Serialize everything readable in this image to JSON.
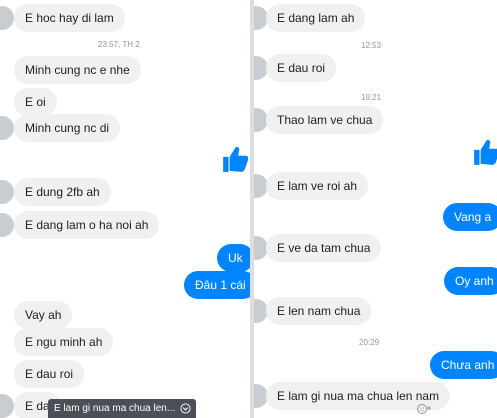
{
  "left": {
    "messages": [
      {
        "text": "E hoc hay di lam",
        "side": "in"
      },
      {
        "text": "23:57, TH 2",
        "side": "ts"
      },
      {
        "text": "Minh cung nc e nhe",
        "side": "in"
      },
      {
        "text": "E oi",
        "side": "in"
      },
      {
        "text": "Minh cung nc di",
        "side": "in"
      },
      {
        "text": "",
        "side": "like"
      },
      {
        "text": "E dung 2fb ah",
        "side": "in"
      },
      {
        "text": "E dang lam o ha noi ah",
        "side": "in"
      },
      {
        "text": "Uk",
        "side": "out"
      },
      {
        "text": "Đâu 1 cái",
        "side": "out"
      },
      {
        "text": "Vay ah",
        "side": "in"
      },
      {
        "text": "E ngu minh ah",
        "side": "in"
      },
      {
        "text": "E dau roi",
        "side": "in"
      },
      {
        "text": "E da",
        "side": "in"
      }
    ],
    "tooltip": "E lam gi nua ma chua len..."
  },
  "right": {
    "messages": [
      {
        "text": "E dang lam ah",
        "side": "in"
      },
      {
        "text": "12:53",
        "side": "ts"
      },
      {
        "text": "E dau roi",
        "side": "in"
      },
      {
        "text": "19:21",
        "side": "ts"
      },
      {
        "text": "Thao lam ve chua",
        "side": "in"
      },
      {
        "text": "",
        "side": "like"
      },
      {
        "text": "E lam ve roi ah",
        "side": "in"
      },
      {
        "text": "Vang a",
        "side": "out"
      },
      {
        "text": "E ve da tam chua",
        "side": "in"
      },
      {
        "text": "Oy anh",
        "side": "out"
      },
      {
        "text": "E len nam chua",
        "side": "in"
      },
      {
        "text": "20:29",
        "side": "ts"
      },
      {
        "text": "Chưa anh",
        "side": "out"
      },
      {
        "text": "E lam gi nua ma chua len nam",
        "side": "in"
      }
    ]
  },
  "icons": {
    "like": "thumbs-up-icon",
    "avatar": "avatar",
    "chevron": "chevron-down-icon",
    "react": "add-reaction-icon"
  },
  "colors": {
    "outgoing": "#0084ff",
    "incoming": "#f1f0f0",
    "like": "#0084ff",
    "timestamp": "#90949c"
  }
}
